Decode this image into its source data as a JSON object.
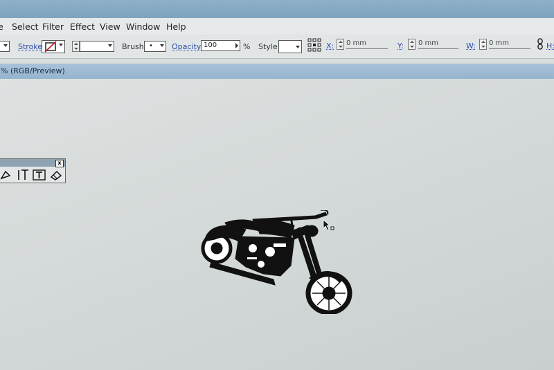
{
  "menu": {
    "items": [
      {
        "label": "e"
      },
      {
        "label": "Select"
      },
      {
        "label": "Filter"
      },
      {
        "label": "Effect"
      },
      {
        "label": "View"
      },
      {
        "label": "Window"
      },
      {
        "label": "Help"
      }
    ]
  },
  "control_bar": {
    "stroke_label": "Stroke:",
    "brush_label": "Brush:",
    "brush_value": "•",
    "opacity_label": "Opacity:",
    "opacity_value": "100",
    "opacity_unit": "%",
    "style_label": "Style:",
    "x_label": "X:",
    "x_value": "0 mm",
    "y_label": "Y:",
    "y_value": "0 mm",
    "w_label": "W:",
    "w_value": "0 mm",
    "h_label": "H:"
  },
  "document": {
    "tab_title": "% (RGB/Preview)"
  },
  "tool_panel": {
    "close_label": "x",
    "tools": [
      "pen-icon",
      "vertical-type-icon",
      "area-type-icon",
      "eraser-icon"
    ]
  },
  "artwork": {
    "subject": "motorcycle-icon",
    "color": "#111111"
  },
  "colors": {
    "title_bar": "#87aac3",
    "link_label": "#2a4fa8",
    "canvas": "#d7dbdb"
  }
}
